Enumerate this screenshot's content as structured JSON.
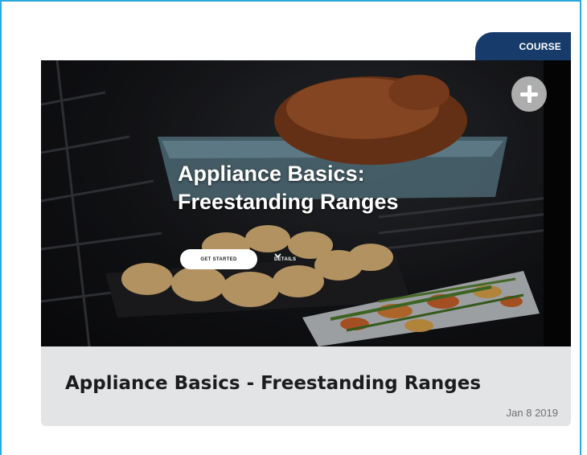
{
  "badge": {
    "label": "COURSE"
  },
  "hero": {
    "title": "Appliance Basics:\nFreestanding Ranges",
    "title_line1": "Appliance Basics:",
    "title_line2": "Freestanding Ranges",
    "get_started_label": "GET STARTED",
    "details_label": "DETAILS"
  },
  "card": {
    "title": "Appliance Basics - Freestanding Ranges",
    "date": "Jan 8 2019"
  },
  "icons": {
    "add": "plus-circle-icon",
    "details": "chevron-down-icon"
  },
  "colors": {
    "frame_border": "#2aa9dc",
    "badge_bg": "#173b6a",
    "card_footer_bg": "#e3e4e6"
  }
}
